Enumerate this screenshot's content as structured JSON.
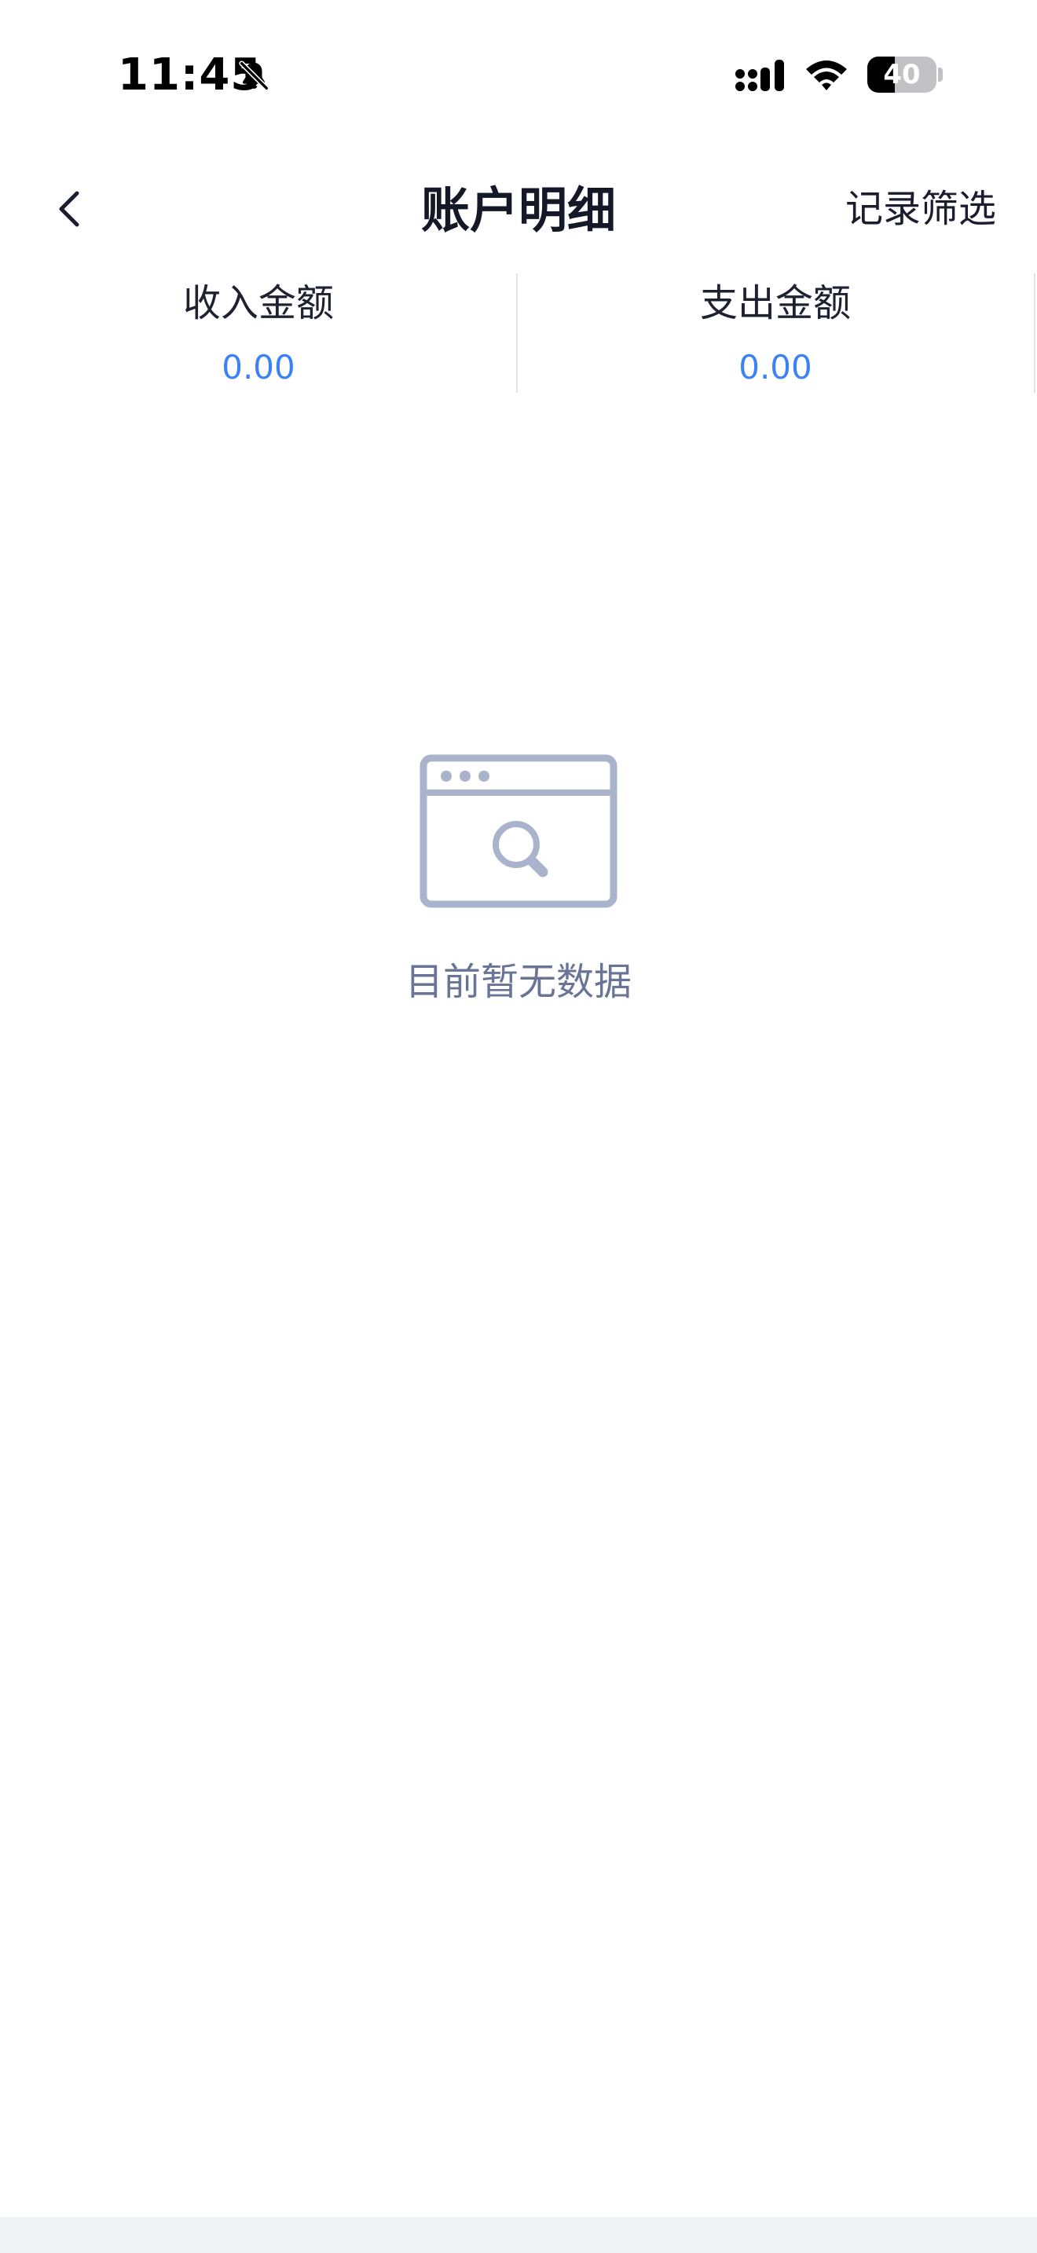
{
  "status_bar": {
    "time": "11:45",
    "bell_icon": "bell-slash-icon",
    "signal_icon": "cellular-signal-icon",
    "wifi_icon": "wifi-icon",
    "battery_level": "40",
    "battery_fraction": 0.4
  },
  "nav": {
    "back_icon": "chevron-left-icon",
    "title": "账户明细",
    "filter_label": "记录筛选"
  },
  "summary": {
    "income_label": "收入金额",
    "income_value": "0.00",
    "expense_label": "支出金额",
    "expense_value": "0.00",
    "value_color": "#3b82f6"
  },
  "empty_state": {
    "icon": "browser-search-icon",
    "message": "目前暂无数据",
    "icon_color": "#aab3cc"
  }
}
